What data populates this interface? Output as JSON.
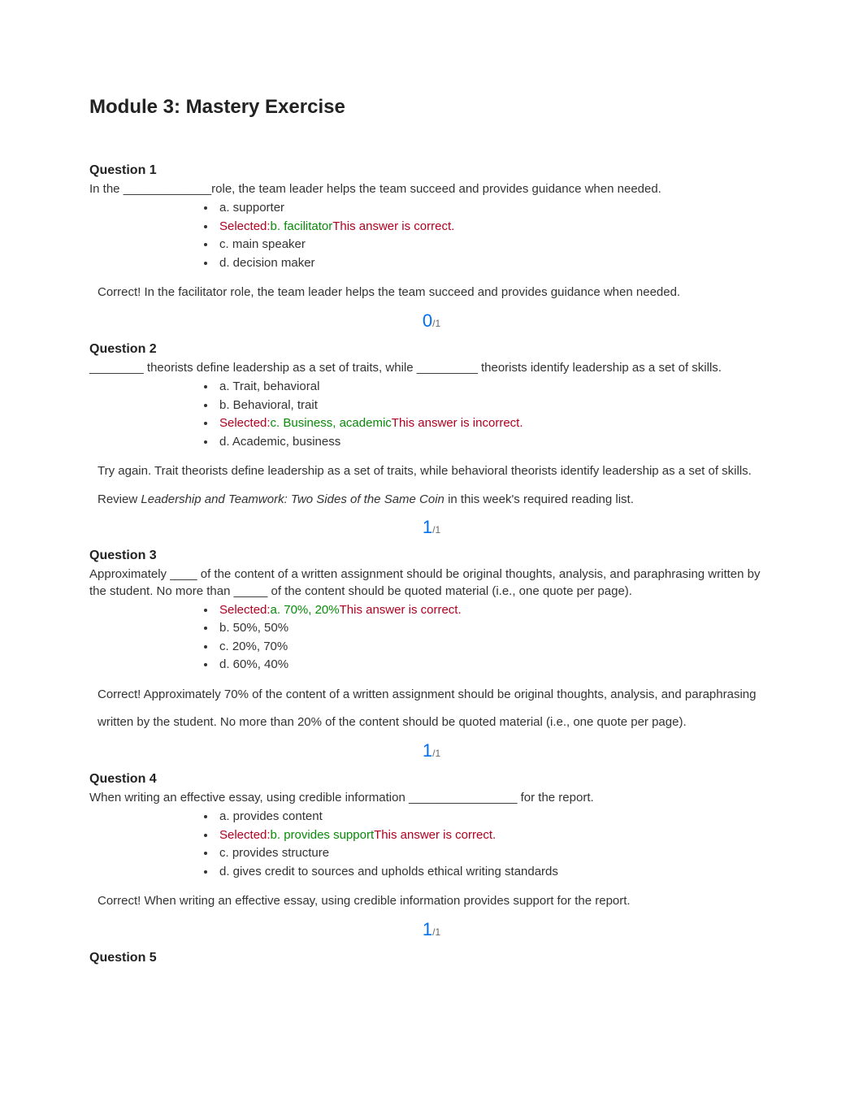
{
  "title": "Module 3: Mastery Exercise",
  "questions": [
    {
      "header": "Question 1",
      "prompt": "In the _____________role, the team leader helps the team succeed and provides guidance when needed.",
      "options": [
        {
          "label": "a. supporter",
          "selected": false,
          "status": ""
        },
        {
          "label": "b. facilitator",
          "selected": true,
          "status": "This answer is correct."
        },
        {
          "label": "c. main speaker",
          "selected": false,
          "status": ""
        },
        {
          "label": "d. decision maker",
          "selected": false,
          "status": ""
        }
      ],
      "feedback_plain": "Correct! In the facilitator role, the team leader helps the team succeed and provides guidance when needed.",
      "score_num": "0",
      "score_denom": "/1",
      "score_class": "incorrect"
    },
    {
      "header": "Question 2",
      "prompt": "________ theorists define leadership as a set of traits, while _________ theorists identify leadership as a set of skills.",
      "options": [
        {
          "label": "a. Trait, behavioral",
          "selected": false,
          "status": ""
        },
        {
          "label": "b. Behavioral, trait",
          "selected": false,
          "status": ""
        },
        {
          "label": "c. Business, academic",
          "selected": true,
          "status": "This answer is incorrect."
        },
        {
          "label": "d. Academic, business",
          "selected": false,
          "status": ""
        }
      ],
      "feedback_pre": "Try again. Trait theorists define leadership as a set of traits, while behavioral theorists identify leadership as a set of skills. Review ",
      "feedback_italic": "Leadership and Teamwork: Two Sides of the Same Coin",
      "feedback_post": " in this week's required reading list.",
      "score_num": "1",
      "score_denom": "/1",
      "score_class": "correct"
    },
    {
      "header": "Question 3",
      "prompt": "Approximately ____ of the content of a written assignment should be original thoughts, analysis, and paraphrasing written by the student. No more than _____ of the content should be quoted material (i.e., one quote per page).",
      "options": [
        {
          "label": "a. 70%, 20%",
          "selected": true,
          "status": "This answer is correct."
        },
        {
          "label": "b. 50%, 50%",
          "selected": false,
          "status": ""
        },
        {
          "label": "c. 20%, 70%",
          "selected": false,
          "status": ""
        },
        {
          "label": "d. 60%, 40%",
          "selected": false,
          "status": ""
        }
      ],
      "feedback_plain": "Correct! Approximately 70% of the content of a written assignment should be original thoughts, analysis, and paraphrasing written by the student. No more than 20% of the content should be quoted material (i.e., one quote per page).",
      "score_num": "1",
      "score_denom": "/1",
      "score_class": "correct"
    },
    {
      "header": "Question 4",
      "prompt": "When writing an effective essay, using credible information ________________ for the report.",
      "options": [
        {
          "label": "a. provides content",
          "selected": false,
          "status": ""
        },
        {
          "label": "b. provides support",
          "selected": true,
          "status": "This answer is correct."
        },
        {
          "label": "c. provides structure",
          "selected": false,
          "status": ""
        },
        {
          "label": "d. gives credit to sources and upholds ethical writing standards",
          "selected": false,
          "status": ""
        }
      ],
      "feedback_plain": "Correct! When writing an effective essay, using credible information provides support for the report.",
      "score_num": "1",
      "score_denom": "/1",
      "score_class": "correct"
    },
    {
      "header": "Question 5"
    }
  ],
  "selected_prefix": "Selected:"
}
